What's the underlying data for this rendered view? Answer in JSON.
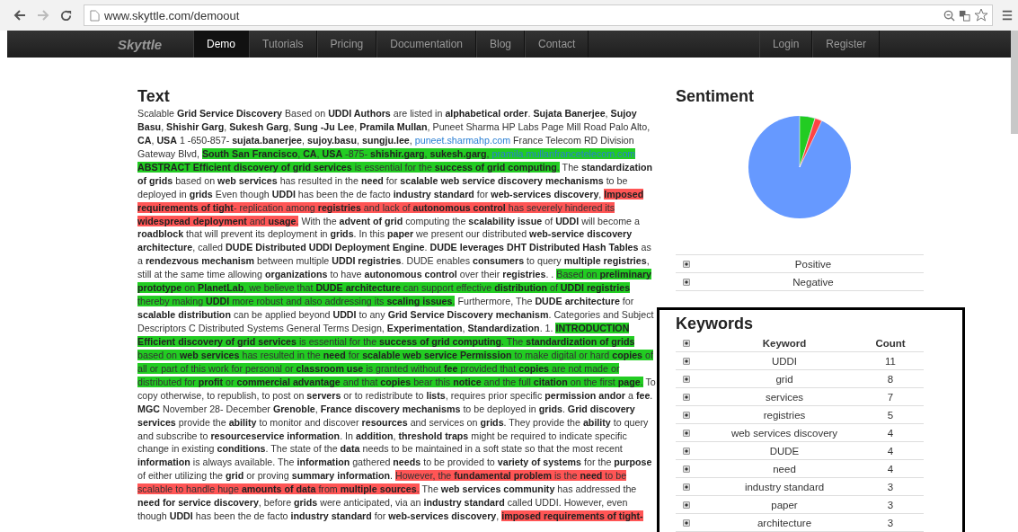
{
  "browser": {
    "url": "www.skyttle.com/demoout"
  },
  "nav": {
    "brand": "Skyttle",
    "items": [
      {
        "label": "Demo",
        "selected": true
      },
      {
        "label": "Tutorials",
        "selected": false
      },
      {
        "label": "Pricing",
        "selected": false
      },
      {
        "label": "Documentation",
        "selected": false
      },
      {
        "label": "Blog",
        "selected": false
      },
      {
        "label": "Contact",
        "selected": false
      }
    ],
    "account": [
      "Login",
      "Register"
    ]
  },
  "text_panel": {
    "title": "Text",
    "segments": [
      {
        "kind": "text",
        "text": "Scalable **Grid Service Discovery** Based on **UDDI Authors** are listed in **alphabetical order**. **Sujata Banerjee**, **Sujoy Basu**, **Shishir Garg**, **Sukesh Garg**, **Sung -Ju Lee**, **Pramila Mullan**, Puneet Sharma HP Labs Page Mill Road Palo Alto, **CA**, **USA** 1 -650-857- **sujata.banerjee**, **sujoy.basu**, **sungju.lee**, "
      },
      {
        "kind": "link",
        "text": "puneet.sharmahp.com"
      },
      {
        "kind": "text",
        "text": " France Telecom RD Division Gateway Blvd, "
      },
      {
        "kind": "text",
        "color": "#22cc22",
        "text": "**South San Francisco**, **CA**, **USA** -875- **shishir.garg**, **sukesh.garg**, "
      },
      {
        "kind": "link",
        "color": "#22cc22",
        "text": "pramila.mullanfrancetelecom.com"
      },
      {
        "kind": "text",
        "color": "#22cc22",
        "text": " **ABSTRACT Efficient discovery of grid services** is essential for the **success of grid computing**."
      },
      {
        "kind": "text",
        "text": " The **standardization of grids** based on **web services** has resulted in the **need** for **scalable web service discovery mechanisms** to be deployed in **grids** Even though **UDDI** has been the de facto **industry standard** for **web-services discovery**, "
      },
      {
        "kind": "text",
        "color": "#ff5555",
        "text": "**Imposed requirements of tight**- replication among **registries** and lack of **autonomous control** has severely hindered its **widespread deployment** and **usage**."
      },
      {
        "kind": "text",
        "text": " With the **advent of grid** computing the **scalability issue** of **UDDI** will become a **roadblock** that will prevent its deployment in **grids**. In this **paper** we present our distributed **web-service discovery architecture**, called **DUDE Distributed UDDI Deployment Engine**. **DUDE leverages DHT Distributed Hash Tables** as a **rendezvous mechanism** between multiple **UDDI registries**. DUDE enables **consumers** to query **multiple registries**, still at the same time allowing **organizations** to have **autonomous control** over their **registries**. . "
      },
      {
        "kind": "text",
        "color": "#22cc22",
        "text": "Based on **preliminary prototype** on **PlanetLab**, we believe that **DUDE architecture** can support effective **distribution** of **UDDI registries** thereby making **UDDI** more robust and also addressing its **scaling issues**."
      },
      {
        "kind": "text",
        "text": " Furthermore, The **DUDE architecture** for **scalable distribution** can be applied beyond **UDDI** to any **Grid Service Discovery mechanism**. Categories and Subject Descriptors C Distributed Systems General Terms Design, **Experimentation**, **Standardization**. 1. "
      },
      {
        "kind": "text",
        "color": "#22cc22",
        "text": "**INTRODUCTION Efficient discovery of grid services** is essential for the **success of grid computing**. "
      },
      {
        "kind": "text",
        "color": "#22cc22",
        "text": "The **standardization of grids** based on **web services** has resulted in the **need** for **scalable web service Permission** to make digital or hard **copies** of all or part of this work for personal or **classroom use** is granted without **fee** provided that **copies** are not made or distributed for **profit** or **commercial advantage** and that **copies** bear this **notice** and the full **citation** on the first **page**."
      },
      {
        "kind": "text",
        "text": " To copy otherwise, to republish, to post on **servers** or to redistribute to **lists**, requires prior specific **permission andor** a **fee**. **MGC** November 28- December **Grenoble**, **France discovery mechanisms** to be deployed in **grids**. **Grid discovery services** provide the **ability** to monitor and discover **resources** and services on **grids**. They provide the **ability** to query and subscribe to **resourceservice information**. In **addition**, **threshold traps** might be required to indicate specific change in existing **conditions**. The state of the **data** needs to be maintained in a soft state so that the most recent **information** is always available. The **information** gathered **needs** to be provided to **variety of systems** for the **purpose** of either utilizing the **grid** or proving **summary information**. "
      },
      {
        "kind": "text",
        "color": "#ff5555",
        "text": "However, the **fundamental problem** is the **need** to be scalable to handle huge **amounts of data** from **multiple sources**."
      },
      {
        "kind": "text",
        "text": " The **web services community** has addressed the **need for service discovery**, before **grids** were anticipated, via an **industry standard** called UDDI. However, even though **UDDI** has been the de facto **industry standard** for **web-services discovery**, "
      },
      {
        "kind": "text",
        "color": "#ff5555",
        "text": "**imposed requirements of tight-**"
      }
    ]
  },
  "sentiment": {
    "title": "Sentiment",
    "legend": [
      {
        "label": "Positive",
        "checked": true
      },
      {
        "label": "Negative",
        "checked": true
      }
    ]
  },
  "keywords": {
    "title": "Keywords",
    "header_checked": true,
    "columns": [
      "Keyword",
      "Count"
    ],
    "rows": [
      {
        "keyword": "UDDI",
        "count": "11",
        "checked": true
      },
      {
        "keyword": "grid",
        "count": "8",
        "checked": true
      },
      {
        "keyword": "services",
        "count": "7",
        "checked": true
      },
      {
        "keyword": "registries",
        "count": "5",
        "checked": true
      },
      {
        "keyword": "web services discovery",
        "count": "4",
        "checked": true
      },
      {
        "keyword": "DUDE",
        "count": "4",
        "checked": true
      },
      {
        "keyword": "need",
        "count": "4",
        "checked": true
      },
      {
        "keyword": "industry standard",
        "count": "3",
        "checked": true
      },
      {
        "keyword": "paper",
        "count": "3",
        "checked": true
      },
      {
        "keyword": "architecture",
        "count": "3",
        "checked": true
      }
    ]
  }
}
